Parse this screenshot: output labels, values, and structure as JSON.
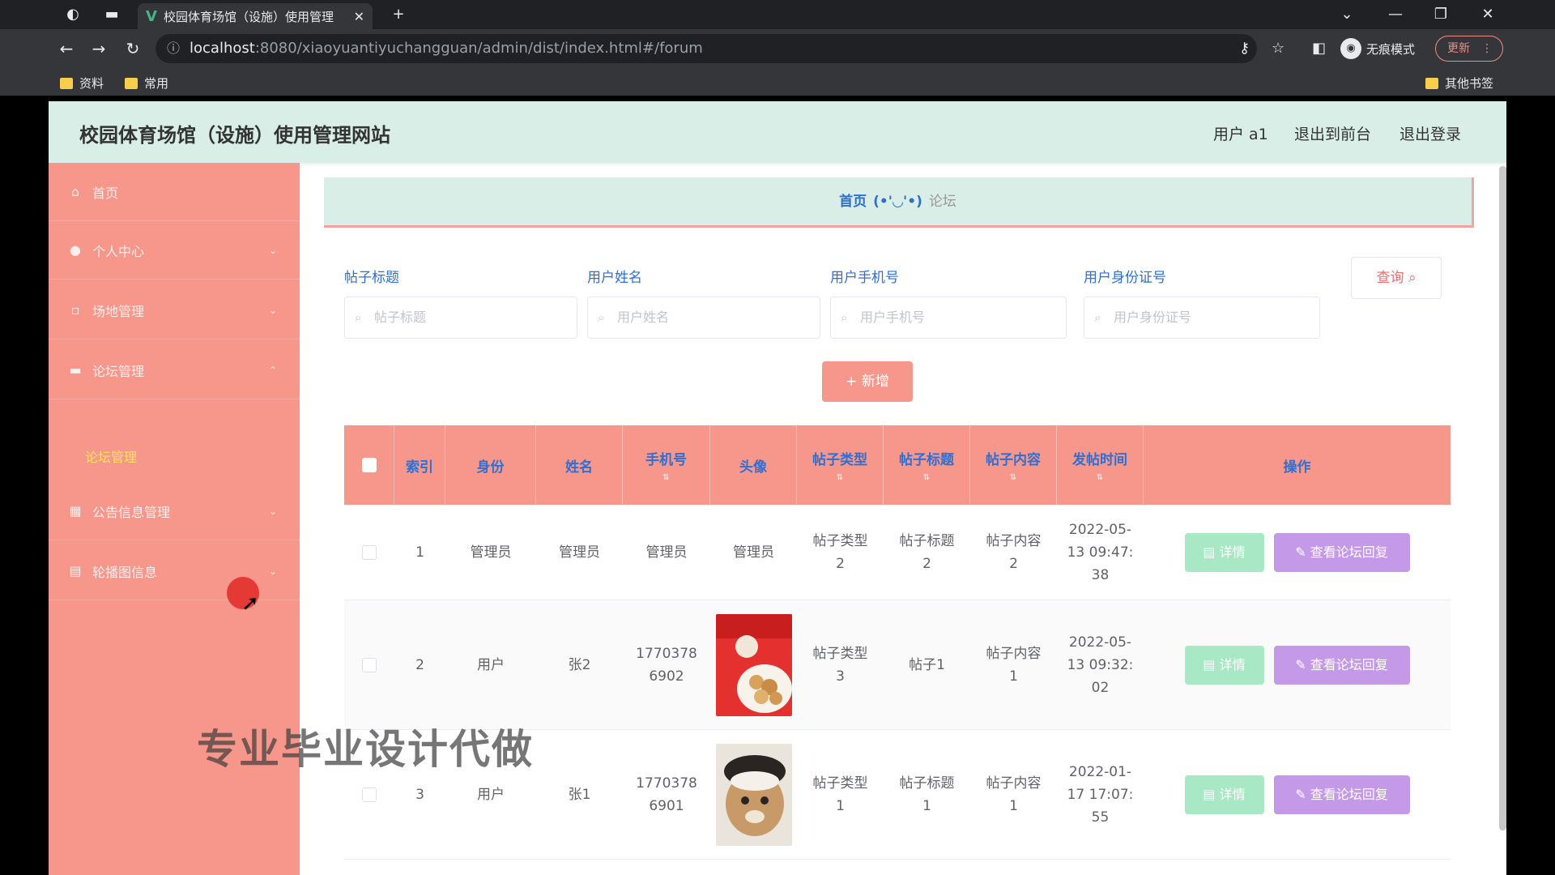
{
  "browser": {
    "tab_title": "校园体育场馆（设施）使用管理",
    "url_host": "localhost",
    "url_path": ":8080/xiaoyuantiyuchangguan/admin/dist/index.html#/forum",
    "incognito_label": "无痕模式",
    "update_label": "更新",
    "bookmarks": [
      "资料",
      "常用"
    ],
    "other_bookmarks": "其他书签"
  },
  "header": {
    "site_title": "校园体育场馆（设施）使用管理网站",
    "user": "用户 a1",
    "back_to_front": "退出到前台",
    "logout": "退出登录"
  },
  "sidebar": {
    "items": [
      {
        "label": "首页",
        "icon": "home-icon"
      },
      {
        "label": "个人中心",
        "icon": "user-icon"
      },
      {
        "label": "场地管理",
        "icon": "venue-icon"
      },
      {
        "label": "论坛管理",
        "icon": "forum-icon"
      },
      {
        "label": "公告信息管理",
        "icon": "grid-icon"
      },
      {
        "label": "轮播图信息",
        "icon": "carousel-icon"
      }
    ],
    "sub_item": "论坛管理"
  },
  "breadcrumb": {
    "home": "首页",
    "sep": "(•'◡'•)",
    "current": "论坛"
  },
  "filters": {
    "labels": [
      "帖子标题",
      "用户姓名",
      "用户手机号",
      "用户身份证号"
    ],
    "placeholders": [
      "帖子标题",
      "用户姓名",
      "用户手机号",
      "用户身份证号"
    ],
    "query_label": "查询",
    "add_label": "+ 新增"
  },
  "table": {
    "headers": [
      "索引",
      "身份",
      "姓名",
      "手机号",
      "头像",
      "帖子类型",
      "帖子标题",
      "帖子内容",
      "发帖时间",
      "操作"
    ],
    "rows": [
      {
        "index": "1",
        "role": "管理员",
        "name": "管理员",
        "phone": "管理员",
        "avatar": "管理员",
        "type": "帖子类型2",
        "title": "帖子标题2",
        "content": "帖子内容2",
        "time": "2022-05-13 09:47:38"
      },
      {
        "index": "2",
        "role": "用户",
        "name": "张2",
        "phone": "17703786902",
        "avatar": "",
        "type": "帖子类型3",
        "title": "帖子1",
        "content": "帖子内容1",
        "time": "2022-05-13 09:32:02"
      },
      {
        "index": "3",
        "role": "用户",
        "name": "张1",
        "phone": "17703786901",
        "avatar": "",
        "type": "帖子类型1",
        "title": "帖子标题1",
        "content": "帖子内容1",
        "time": "2022-01-17 17:07:55"
      }
    ],
    "detail_label": "详情",
    "reply_label": "查看论坛回复"
  },
  "watermark": "专业毕业设计代做",
  "colors": {
    "sidebar": "#f7968a",
    "header": "#d8eee6",
    "accent_blue": "#2f6fd2",
    "detail_btn": "#a9e8c4",
    "reply_btn": "#c49ae8"
  }
}
